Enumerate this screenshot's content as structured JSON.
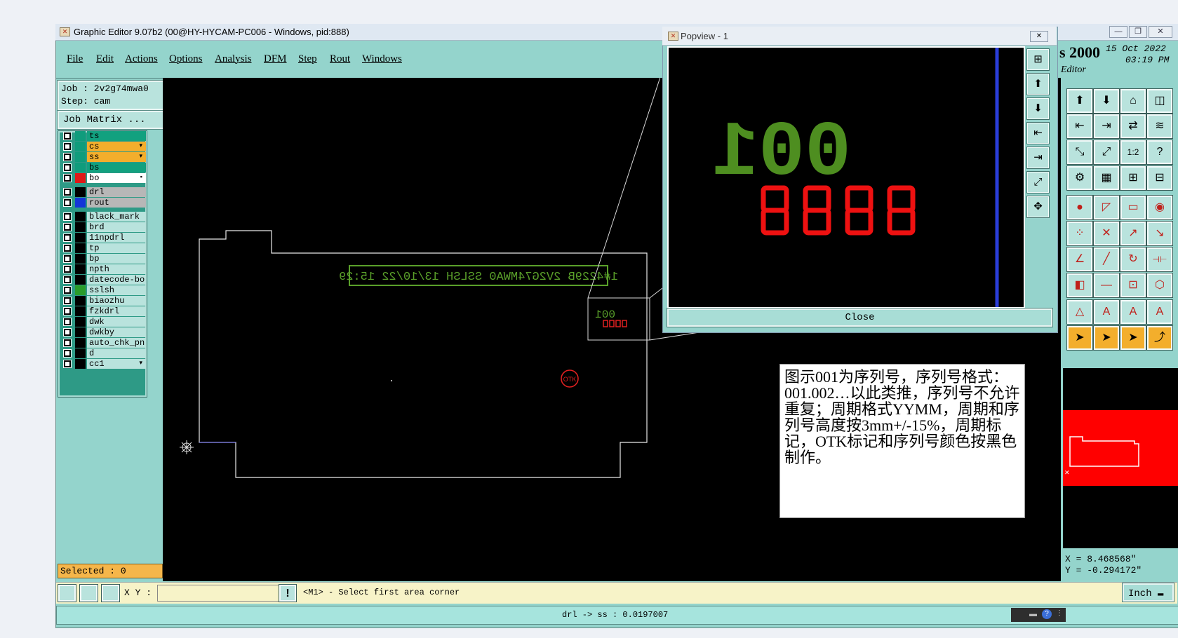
{
  "window": {
    "title": "Graphic Editor 9.07b2 (00@HY-HYCAM-PC006 - Windows, pid:888)",
    "buttons": [
      "—",
      "❐",
      "✕"
    ]
  },
  "menu": [
    "File",
    "Edit",
    "Actions",
    "Options",
    "Analysis",
    "DFM",
    "Step",
    "Rout",
    "Windows"
  ],
  "job": {
    "job_line": "Job : 2v2g74mwa0",
    "step_line": "Step: cam",
    "matrix_label": "Job Matrix ..."
  },
  "layers": [
    {
      "name": "ts",
      "color": "#0f9c7c",
      "bg": "#12a17f",
      "flag": ""
    },
    {
      "name": "cs",
      "color": "#0f9c7c",
      "bg": "#f3ae2c",
      "flag": "▾"
    },
    {
      "name": "ss",
      "color": "#0f9c7c",
      "bg": "#f3ae2c",
      "flag": "▾"
    },
    {
      "name": "bs",
      "color": "#0f9c7c",
      "bg": "#12a17f",
      "flag": ""
    },
    {
      "name": "bo",
      "color": "#e01818",
      "bg": "#ffffff",
      "flag": "▪"
    },
    {
      "name": "drl",
      "color": "#000000",
      "bg": "#b7b7b7",
      "flag": ""
    },
    {
      "name": "rout",
      "color": "#1436d8",
      "bg": "#b7b7b7",
      "flag": ""
    },
    {
      "name": "black_mark",
      "color": "#000000",
      "bg": "#b9e3dd",
      "flag": ""
    },
    {
      "name": "brd",
      "color": "#000000",
      "bg": "#b9e3dd",
      "flag": ""
    },
    {
      "name": "11npdrl",
      "color": "#000000",
      "bg": "#b9e3dd",
      "flag": ""
    },
    {
      "name": "tp",
      "color": "#000000",
      "bg": "#b9e3dd",
      "flag": ""
    },
    {
      "name": "bp",
      "color": "#000000",
      "bg": "#b9e3dd",
      "flag": ""
    },
    {
      "name": "npth",
      "color": "#000000",
      "bg": "#b9e3dd",
      "flag": ""
    },
    {
      "name": "datecode-bo",
      "color": "#000000",
      "bg": "#b9e3dd",
      "flag": ""
    },
    {
      "name": "sslsh",
      "color": "#2a9c2a",
      "bg": "#b9e3dd",
      "flag": ""
    },
    {
      "name": "biaozhu",
      "color": "#000000",
      "bg": "#b9e3dd",
      "flag": ""
    },
    {
      "name": "fzkdrl",
      "color": "#000000",
      "bg": "#b9e3dd",
      "flag": ""
    },
    {
      "name": "dwk",
      "color": "#000000",
      "bg": "#b9e3dd",
      "flag": ""
    },
    {
      "name": "dwkby",
      "color": "#000000",
      "bg": "#b9e3dd",
      "flag": ""
    },
    {
      "name": "auto_chk_pn",
      "color": "#000000",
      "bg": "#b9e3dd",
      "flag": ""
    },
    {
      "name": "d",
      "color": "#000000",
      "bg": "#b9e3dd",
      "flag": ""
    },
    {
      "name": "cc1",
      "color": "#000000",
      "bg": "#b9e3dd",
      "flag": "▾"
    }
  ],
  "selected_label": "Selected : 0",
  "canvas": {
    "silkscreen_text": "1#4229B 2V2G74MWA0 SSLSH 13/10/22 15:29",
    "serial_small": "001",
    "otk_label": "OTK"
  },
  "popview": {
    "title": "Popview - 1",
    "serial": "001",
    "close_label": "Close"
  },
  "brand": {
    "version": "s 2000",
    "date": "15 Oct 2022",
    "time": "03:19 PM",
    "subtitle": "Editor"
  },
  "note": "图示001为序列号，序列号格式：001.002…以此类推，序列号不允许重复；周期格式YYMM，周期和序列号高度按3mm+/-15%，周期标记，OTK标记和序列号颜色按黑色制作。",
  "coords": {
    "x": "X = 8.468568\"",
    "y": "Y = -0.294172\""
  },
  "command": {
    "xy_label": "X Y :",
    "xy_value": "",
    "prompt": "<M1> - Select first area corner",
    "unit": "Inch"
  },
  "status": "drl -> ss : 0.0197007"
}
